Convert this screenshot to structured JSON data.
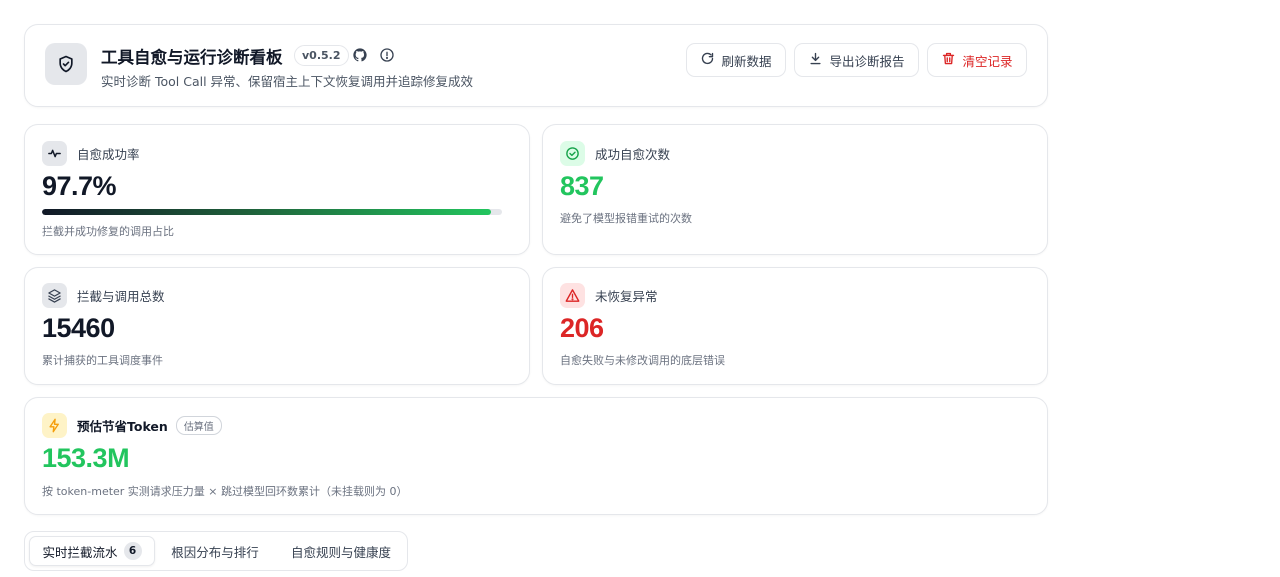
{
  "header": {
    "title": "工具自愈与运行诊断看板",
    "version": "v0.5.2",
    "subtitle": "实时诊断 Tool Call 异常、保留宿主上下文恢复调用并追踪修复成效",
    "buttons": {
      "refresh": "刷新数据",
      "export": "导出诊断报告",
      "clear": "清空记录"
    }
  },
  "stats": {
    "success_rate": {
      "label": "自愈成功率",
      "value": "97.7%",
      "progress": 0.977,
      "desc": "拦截并成功修复的调用占比"
    },
    "success_count": {
      "label": "成功自愈次数",
      "value": "837",
      "desc": "避免了模型报错重试的次数"
    },
    "total": {
      "label": "拦截与调用总数",
      "value": "15460",
      "desc": "累计捕获的工具调度事件"
    },
    "unrecovered": {
      "label": "未恢复异常",
      "value": "206",
      "desc": "自愈失败与未修改调用的底层错误"
    },
    "tokens": {
      "label": "预估节省Token",
      "badge": "估算值",
      "value": "153.3M",
      "desc": "按 token-meter 实测请求压力量 × 跳过模型回环数累计（未挂载则为 0）"
    }
  },
  "tabs": [
    {
      "label": "实时拦截流水",
      "count": "6"
    },
    {
      "label": "根因分布与排行"
    },
    {
      "label": "自愈规则与健康度"
    }
  ],
  "colors": {
    "green": "#22c55e",
    "red": "#dc2626",
    "amber": "#f59e0b",
    "ink": "#111827"
  }
}
